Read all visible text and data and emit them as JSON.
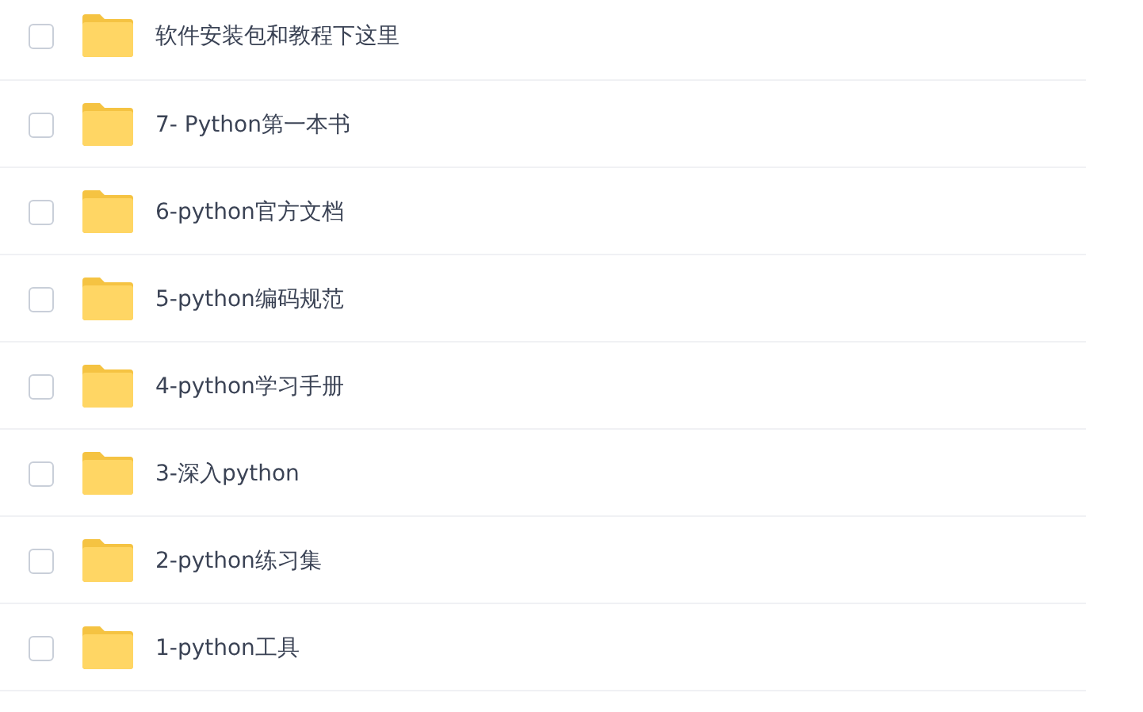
{
  "files": [
    {
      "name": "软件安装包和教程下这里",
      "checked": false
    },
    {
      "name": "7- Python第一本书",
      "checked": false
    },
    {
      "name": "6-python官方文档",
      "checked": false
    },
    {
      "name": "5-python编码规范",
      "checked": false
    },
    {
      "name": "4-python学习手册",
      "checked": false
    },
    {
      "name": "3-深入python",
      "checked": false
    },
    {
      "name": "2-python练习集",
      "checked": false
    },
    {
      "name": "1-python工具",
      "checked": false
    }
  ]
}
